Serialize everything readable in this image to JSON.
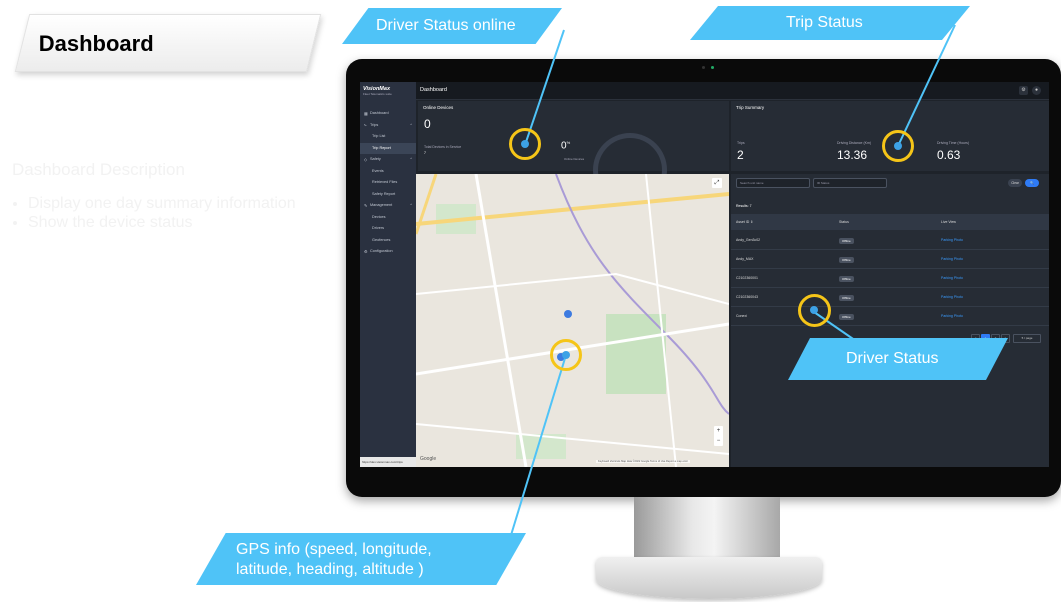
{
  "slide": {
    "title": "Dashboard",
    "description_heading": "Dashboard Description",
    "bullets": [
      "Display one day summary information",
      "Show the device status"
    ]
  },
  "app": {
    "logo": "VisionMax",
    "logo_sub": "Fleet Telematics suite",
    "page_title": "Dashboard",
    "sidebar_items": [
      {
        "icon": "grid-icon",
        "glyph": "▦",
        "label": "Dashboard",
        "sub": false,
        "active": false,
        "chevron": ""
      },
      {
        "icon": "route-icon",
        "glyph": "⤷",
        "label": "Trips",
        "sub": false,
        "active": false,
        "chevron": "^"
      },
      {
        "icon": "",
        "glyph": "",
        "label": "Trip List",
        "sub": true,
        "active": false,
        "chevron": ""
      },
      {
        "icon": "",
        "glyph": "",
        "label": "Trip Report",
        "sub": true,
        "active": true,
        "chevron": ""
      },
      {
        "icon": "shield-icon",
        "glyph": "◇",
        "label": "Safety",
        "sub": false,
        "active": false,
        "chevron": "^"
      },
      {
        "icon": "",
        "glyph": "",
        "label": "Events",
        "sub": true,
        "active": false,
        "chevron": ""
      },
      {
        "icon": "",
        "glyph": "",
        "label": "Retrieved Files",
        "sub": true,
        "active": false,
        "chevron": ""
      },
      {
        "icon": "",
        "glyph": "",
        "label": "Safety Report",
        "sub": true,
        "active": false,
        "chevron": ""
      },
      {
        "icon": "wrench-icon",
        "glyph": "✎",
        "label": "Management",
        "sub": false,
        "active": false,
        "chevron": "^"
      },
      {
        "icon": "",
        "glyph": "",
        "label": "Devices",
        "sub": true,
        "active": false,
        "chevron": ""
      },
      {
        "icon": "",
        "glyph": "",
        "label": "Drivers",
        "sub": true,
        "active": false,
        "chevron": ""
      },
      {
        "icon": "",
        "glyph": "",
        "label": "Geofences",
        "sub": true,
        "active": false,
        "chevron": ""
      },
      {
        "icon": "gear-icon",
        "glyph": "⚙",
        "label": "Configuration",
        "sub": false,
        "active": false,
        "chevron": ""
      }
    ],
    "status_url": "https://dev.visionmax.com/trips",
    "online_devices": {
      "title": "Online Devices",
      "count": "0",
      "total_label": "Total Devices in Service",
      "total_value": "7",
      "gauge_value": "0",
      "gauge_unit": "%",
      "gauge_label": "Online Devices"
    },
    "trip_summary": {
      "title": "Trip Summary",
      "columns": [
        {
          "label": "Trips",
          "value": "2"
        },
        {
          "label": "Driving Distance (Km)",
          "value": "13.36"
        },
        {
          "label": "Driving Time (Hours)",
          "value": "0.63"
        }
      ]
    },
    "map": {
      "attribution": "Keyboard shortcuts  Map data ©2022 Google  Terms of Use  Report a map error",
      "google": "Google",
      "zoom_in": "+",
      "zoom_out": "−",
      "expand": "⤢"
    },
    "devices": {
      "search_placeholder": "Search unit name",
      "id_placeholder": "ID Status",
      "clear": "Clear",
      "search_btn": "🔍",
      "results": "Results: 7",
      "headers": [
        "Asset ID ⇕",
        "Status",
        "Live View"
      ],
      "rows": [
        {
          "id": "Andy_Gen3c02",
          "status": "Offline",
          "live": "Parking Photo"
        },
        {
          "id": "Andy_MAX",
          "status": "Offline",
          "live": "Parking Photo"
        },
        {
          "id": "C2102360001",
          "status": "Offline",
          "live": "Parking Photo"
        },
        {
          "id": "C2102360043",
          "status": "Offline",
          "live": "Parking Photo"
        },
        {
          "id": "Conexi",
          "status": "Offline",
          "live": "Parking Photo"
        }
      ],
      "pager": [
        "<",
        "1",
        "2",
        ">"
      ],
      "per_page": "5 / page"
    }
  },
  "callouts": {
    "driver_status_online": "Driver Status online",
    "trip_status": "Trip Status",
    "driver_status": "Driver Status",
    "gps_line1": "GPS info (speed, longitude,",
    "gps_line2": "latitude, heading, altitude )"
  },
  "colors": {
    "callout": "#4fc3f7",
    "ring": "#f5c518",
    "screen_bg": "#1e232a",
    "sidebar_bg": "#2a3140"
  }
}
